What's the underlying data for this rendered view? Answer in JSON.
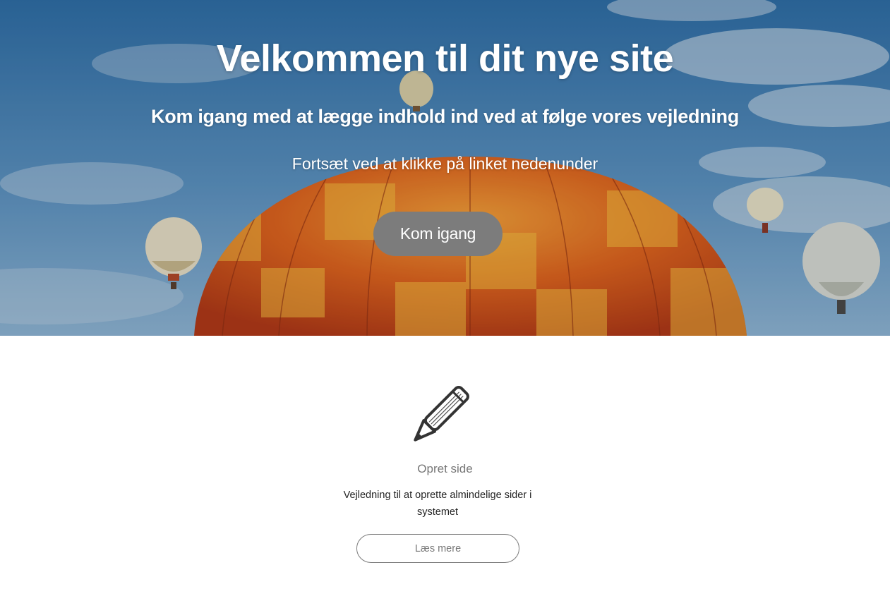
{
  "hero": {
    "title": "Velkommen til dit nye site",
    "subtitle": "Kom igang med at lægge indhold ind ved at følge vores vejledning",
    "text": "Fortsæt ved at klikke på linket nedenunder",
    "button_label": "Kom igang",
    "background": "hot-air-balloons-photo"
  },
  "feature": {
    "icon": "pencil-icon",
    "title": "Opret side",
    "description": "Vejledning til at oprette almindelige sider i systemet",
    "button_label": "Læs mere"
  },
  "colors": {
    "hero_button_bg": "#7c7c7c",
    "feature_title": "#777777",
    "feature_button_border": "#7a7a7a"
  }
}
